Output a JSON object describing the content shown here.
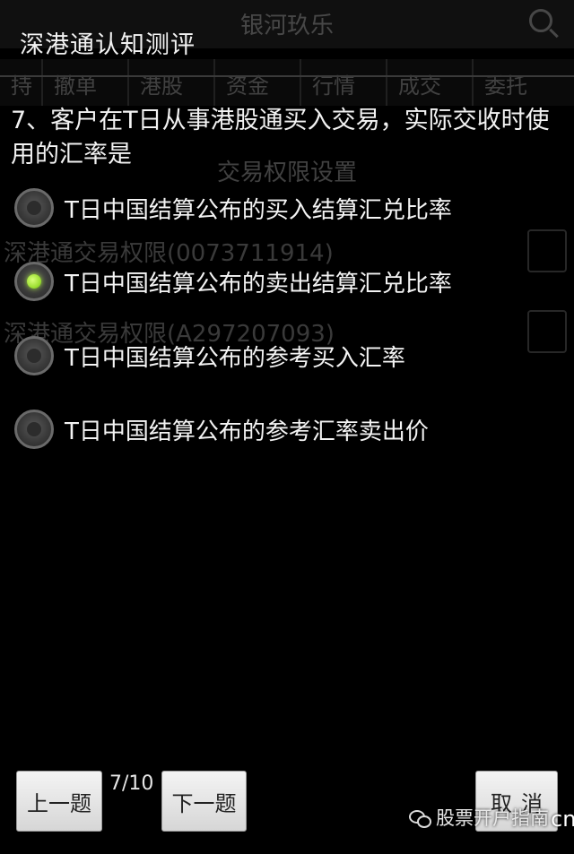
{
  "background_app": {
    "title": "银河玖乐",
    "tabs": [
      "持",
      "撤单",
      "港股",
      "资金",
      "行情",
      "成交",
      "委托"
    ],
    "section_title": "交易权限设置",
    "rows": [
      "深港通交易权限(0073711914)",
      "深港通交易权限(A297207093)"
    ]
  },
  "dialog": {
    "title": "深港通认知测评",
    "question": "7、客户在T日从事港股通买入交易，实际交收时使用的汇率是",
    "options": [
      {
        "label": "T日中国结算公布的买入结算汇兑比率",
        "selected": false
      },
      {
        "label": "T日中国结算公布的卖出结算汇兑比率",
        "selected": true
      },
      {
        "label": "T日中国结算公布的参考买入汇率",
        "selected": false
      },
      {
        "label": "T日中国结算公布的参考汇率卖出价",
        "selected": false
      }
    ],
    "prev_label": "上一题",
    "next_label": "下一题",
    "cancel_label": "取消",
    "progress": "7/10"
  },
  "watermark": {
    "text": "股票开户指南",
    "brand": "cn软荐网"
  },
  "colors": {
    "background": "#000000",
    "radio_selected": "#9ee033",
    "button_face": "#e8e8e8"
  }
}
